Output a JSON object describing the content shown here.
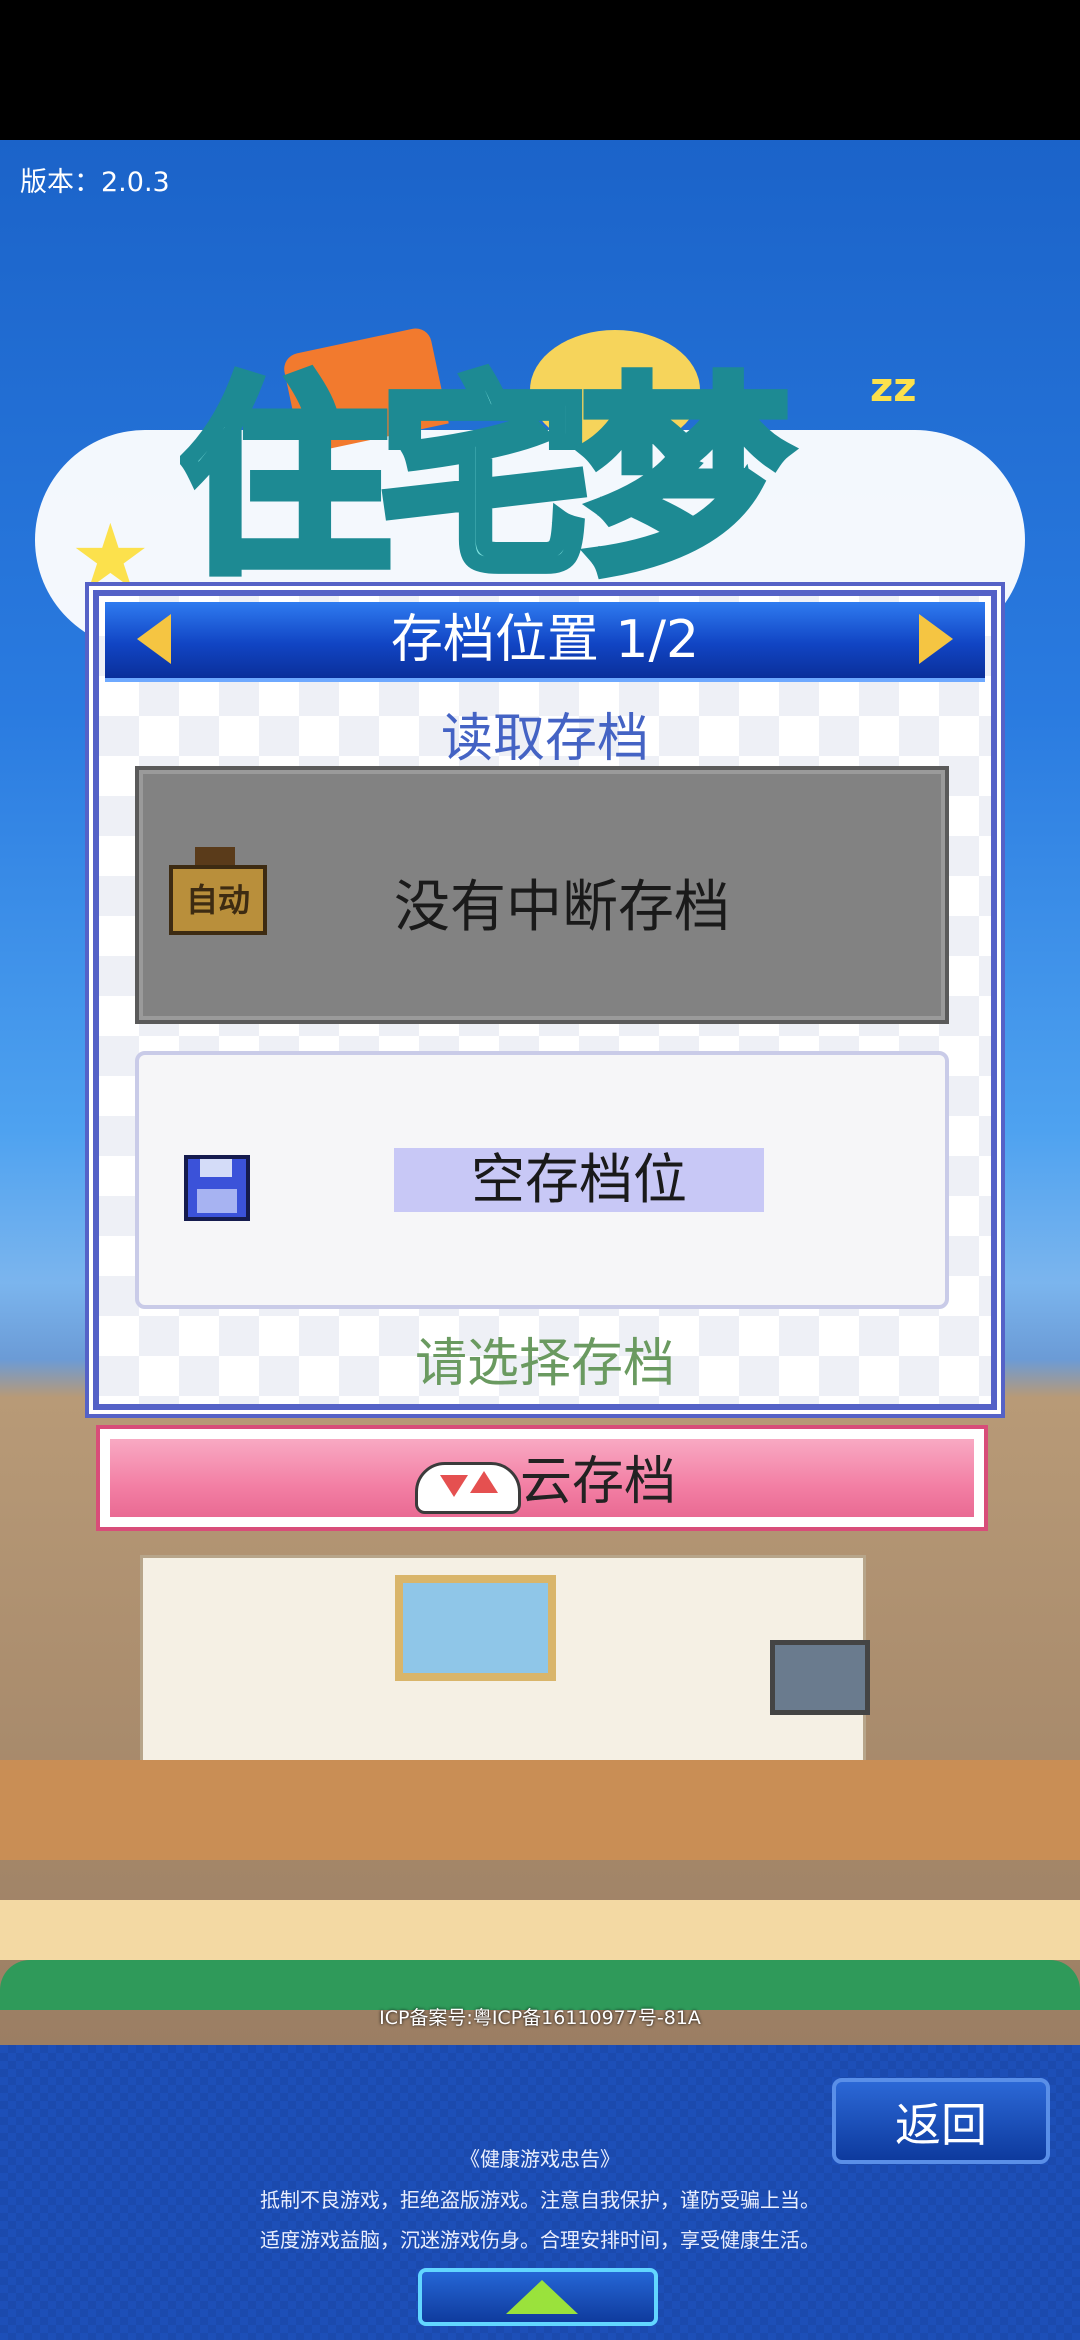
{
  "status": {
    "version": "版本：2.0.3"
  },
  "logo": {
    "title": "住宅梦"
  },
  "dialog": {
    "title": "存档位置 1/2",
    "load_title": "读取存档",
    "auto_slot": {
      "badge": "自动",
      "label": "没有中断存档"
    },
    "empty_slot": {
      "label": "空存档位"
    },
    "select_prompt": "请选择存档"
  },
  "cloud_button": {
    "label": "云存档"
  },
  "footer": {
    "icp": "ICP备案号:粤ICP备16110977号-81A",
    "back_label": "返回",
    "notice_title": "《健康游戏忠告》",
    "notice_line1": "抵制不良游戏，拒绝盗版游戏。注意自我保护，谨防受骗上当。",
    "notice_line2": "适度游戏益脑，沉迷游戏伤身。合理安排时间，享受健康生活。"
  },
  "colors": {
    "header_blue": "#1145c4",
    "cloud_pink": "#f37fa4",
    "panel_blue": "#1d4fb8"
  }
}
